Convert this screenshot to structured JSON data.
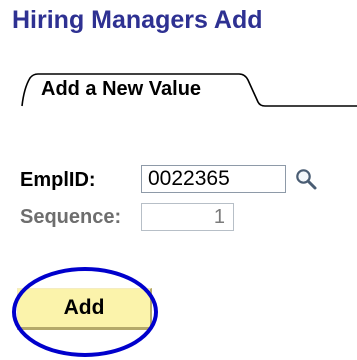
{
  "page": {
    "title": "Hiring Managers Add"
  },
  "tabs": [
    {
      "label": "Add a New Value",
      "active": true
    }
  ],
  "form": {
    "emplid": {
      "label": "EmplID:",
      "value": "0022365"
    },
    "lookup_icon": "magnifying-glass-icon",
    "sequence": {
      "label": "Sequence:",
      "value": "1"
    },
    "add_label": "Add"
  },
  "colors": {
    "title": "#2e3192",
    "button_bg": "#fbf3ab",
    "highlight_circle": "#0000cc"
  }
}
